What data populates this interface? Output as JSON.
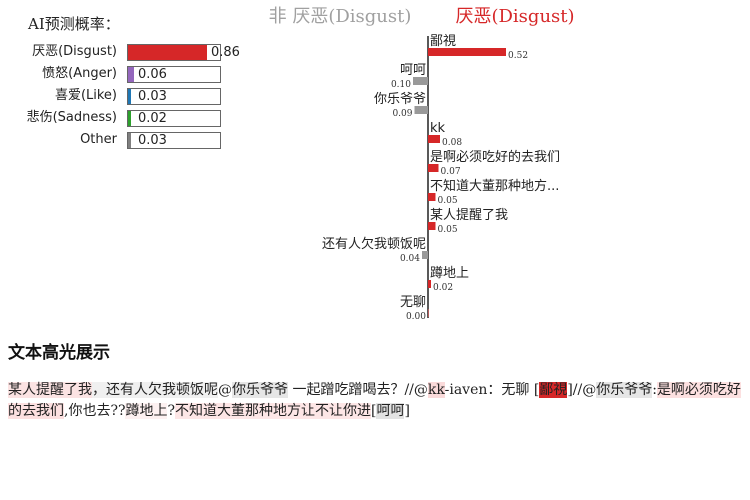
{
  "probabilities": {
    "title": "AI预测概率：",
    "items": [
      {
        "label": "厌恶(Disgust)",
        "value": 0.86,
        "value_text": "0.86",
        "color": "#d62728"
      },
      {
        "label": "愤怒(Anger)",
        "value": 0.06,
        "value_text": "0.06",
        "color": "#9467bd"
      },
      {
        "label": "喜爱(Like)",
        "value": 0.03,
        "value_text": "0.03",
        "color": "#1f77b4"
      },
      {
        "label": "悲伤(Sadness)",
        "value": 0.02,
        "value_text": "0.02",
        "color": "#2ca02c"
      },
      {
        "label": "Other",
        "value": 0.03,
        "value_text": "0.03",
        "color": "#7f7f7f"
      }
    ]
  },
  "chart_data": {
    "type": "bar",
    "orientation": "horizontal-diverging",
    "legend": {
      "negative": "非 厌恶(Disgust)",
      "positive": "厌恶(Disgust)"
    },
    "negative_color": "#999999",
    "positive_color": "#d62728",
    "categories": [
      "鄙視",
      "呵呵",
      "你乐爷爷",
      "kk",
      "是啊必须吃好的去我们",
      "不知道大董那种地方...",
      "某人提醒了我",
      "还有人欠我顿饭呢",
      "蹲地上",
      "无聊"
    ],
    "values": [
      0.52,
      -0.1,
      -0.09,
      0.08,
      0.07,
      0.05,
      0.05,
      -0.04,
      0.02,
      0.0
    ],
    "value_labels": [
      "0.52",
      "0.10",
      "0.09",
      "0.08",
      "0.07",
      "0.05",
      "0.05",
      "0.04",
      "0.02",
      "0.00"
    ]
  },
  "highlight": {
    "title": "文本高光展示",
    "segments": [
      {
        "text": "某人提醒了我",
        "bg": "#fbe3e3"
      },
      {
        "text": "，还有人欠我顿饭呢",
        "bg": "#f0f0f0"
      },
      {
        "text": "@",
        "bg": ""
      },
      {
        "text": "你乐爷爷",
        "bg": "#e6e6e6"
      },
      {
        "text": " 一起蹭吃蹭喝去？//@",
        "bg": ""
      },
      {
        "text": "kk",
        "bg": "#fadada"
      },
      {
        "text": "-iaven：无聊 [",
        "bg": ""
      },
      {
        "text": "鄙視",
        "bg": "#d62728",
        "color": "#222222"
      },
      {
        "text": "]//@",
        "bg": ""
      },
      {
        "text": "你乐爷爷",
        "bg": "#e6e6e6"
      },
      {
        "text": ":",
        "bg": ""
      },
      {
        "text": "是啊必须吃好的去我们",
        "bg": "#fce0e0"
      },
      {
        "text": ",你也去??",
        "bg": ""
      },
      {
        "text": "蹲地上",
        "bg": "#fdf1f1"
      },
      {
        "text": "?",
        "bg": ""
      },
      {
        "text": "不知道大董那种地方让不让你进",
        "bg": "#fde6e6"
      },
      {
        "text": "[",
        "bg": ""
      },
      {
        "text": "呵呵",
        "bg": "#e2e2e2"
      },
      {
        "text": "]",
        "bg": ""
      }
    ]
  }
}
